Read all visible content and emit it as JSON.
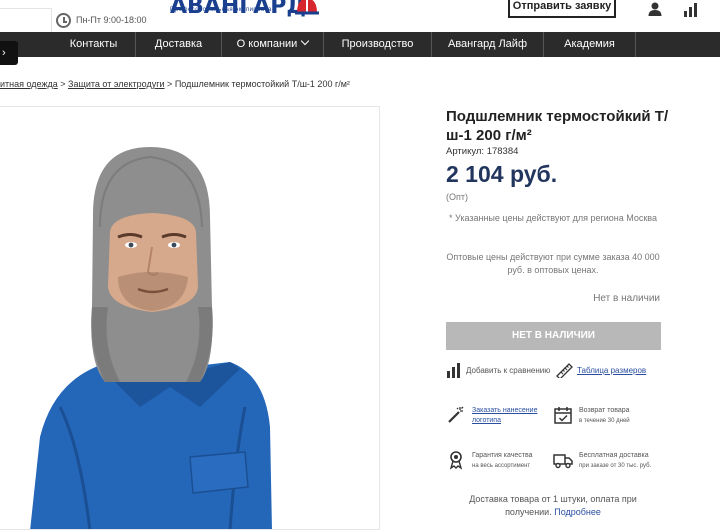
{
  "header": {
    "hours": "Пн-Пт 9:00-18:00",
    "logo_text": "АВАНГАРД",
    "logo_subtitle": "Профессиональная экипировка",
    "send_request_label": "Отправить заявку",
    "side_button_label": "›"
  },
  "nav": {
    "items": [
      {
        "label": "Контакты"
      },
      {
        "label": "Доставка"
      },
      {
        "label": "О компании"
      },
      {
        "label": "Производство"
      },
      {
        "label": "Авангард Лайф"
      },
      {
        "label": "Академия"
      }
    ]
  },
  "breadcrumb": {
    "item1": "итная одежда",
    "sep1": " > ",
    "item2": "Защита от электродуги",
    "sep2": " > ",
    "current": "Подшлемник термостойкий Т/ш-1 200 г/м²"
  },
  "product": {
    "title": "Подшлемник термостойкий Т/ш-1 200 г/м²",
    "sku": "Артикул: 178384",
    "price": "2 104 руб.",
    "price_type": "(Опт)",
    "region_note": "* Указанные цены действуют для региона Москва",
    "wholesale_note": "Оптовые цены действуют при сумме заказа 40 000 руб. в оптовых ценах.",
    "availability": "Нет в наличии",
    "unavailable_button": "НЕТ В НАЛИЧИИ",
    "compare_label": "Добавить к сравнению",
    "size_table_label": "Таблица размеров"
  },
  "features": {
    "logo_line1": "Заказать нанесение",
    "logo_line2": "логотипа",
    "return_line1": "Возврат товара",
    "return_line2": "в течение 30 дней",
    "quality_line1": "Гарантия качества",
    "quality_line2": "на весь ассортимент",
    "delivery_line1": "Бесплатная доставка",
    "delivery_line2": "при заказе от 30 тыс. руб."
  },
  "delivery_note": {
    "text": "Доставка товара от 1 штуки, оплата при получении.",
    "more": "Подробнее"
  },
  "colors": {
    "nav_bg": "#2b2b2b",
    "price": "#22355e",
    "link": "#2a4fa0",
    "disabled_button": "#b8b8b8"
  }
}
